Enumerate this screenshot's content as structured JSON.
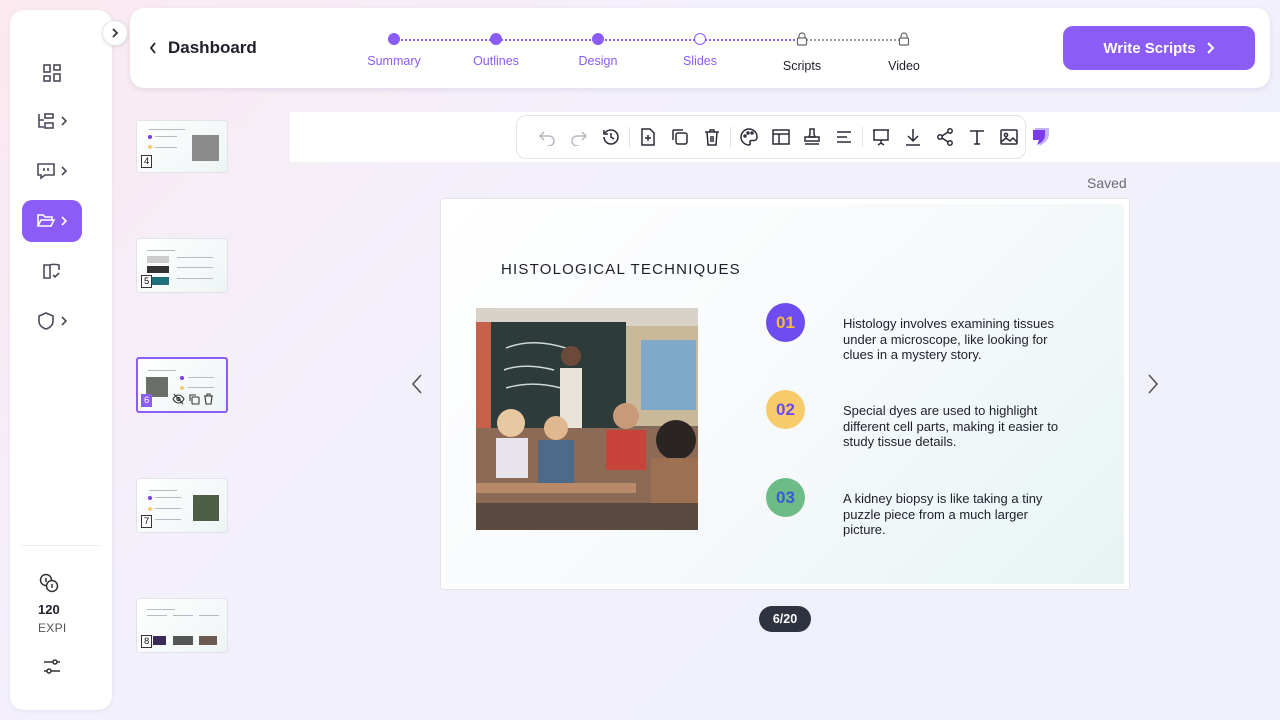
{
  "header": {
    "back_label": "Dashboard",
    "steps": [
      {
        "label": "Summary",
        "state": "done"
      },
      {
        "label": "Outlines",
        "state": "done"
      },
      {
        "label": "Design",
        "state": "done"
      },
      {
        "label": "Slides",
        "state": "current"
      },
      {
        "label": "Scripts",
        "state": "locked"
      },
      {
        "label": "Video",
        "state": "locked"
      }
    ],
    "primary_button": "Write Scripts"
  },
  "sidebar": {
    "items": [
      {
        "icon": "dashboard-grid-icon"
      },
      {
        "icon": "outline-tree-icon"
      },
      {
        "icon": "presentation-chat-icon"
      },
      {
        "icon": "folder-open-icon",
        "active": true
      },
      {
        "icon": "book-check-icon"
      },
      {
        "icon": "shield-icon"
      }
    ],
    "credits_value": "120",
    "credits_unit": "EXPI"
  },
  "toolbar": {
    "tools": [
      "undo-icon",
      "redo-icon",
      "history-icon",
      "add-slide-icon",
      "duplicate-icon",
      "delete-icon",
      "palette-icon",
      "layout-icon",
      "stamp-icon",
      "align-icon",
      "present-icon",
      "download-icon",
      "share-icon",
      "text-icon",
      "image-icon"
    ]
  },
  "status": {
    "saved": "Saved"
  },
  "thumbnails": [
    {
      "number": "4"
    },
    {
      "number": "5"
    },
    {
      "number": "6",
      "active": true
    },
    {
      "number": "7"
    },
    {
      "number": "8"
    }
  ],
  "slide": {
    "title": "HISTOLOGICAL TECHNIQUES",
    "points": [
      {
        "num": "01",
        "text": "Histology involves examining tissues under a microscope, like looking for clues in a mystery story.",
        "badge_bg": "#6d4cf0",
        "badge_fg": "#f5b940"
      },
      {
        "num": "02",
        "text": "Special dyes are used to highlight different cell parts, making it easier to study tissue details.",
        "badge_bg": "#f7cb6a",
        "badge_fg": "#6d4cf0"
      },
      {
        "num": "03",
        "text": "A kidney biopsy is like taking a tiny puzzle piece from a much larger picture.",
        "badge_bg": "#6dbb86",
        "badge_fg": "#3a5bd9"
      }
    ]
  },
  "pager": "6/20",
  "colors": {
    "accent": "#8b5cf6"
  }
}
